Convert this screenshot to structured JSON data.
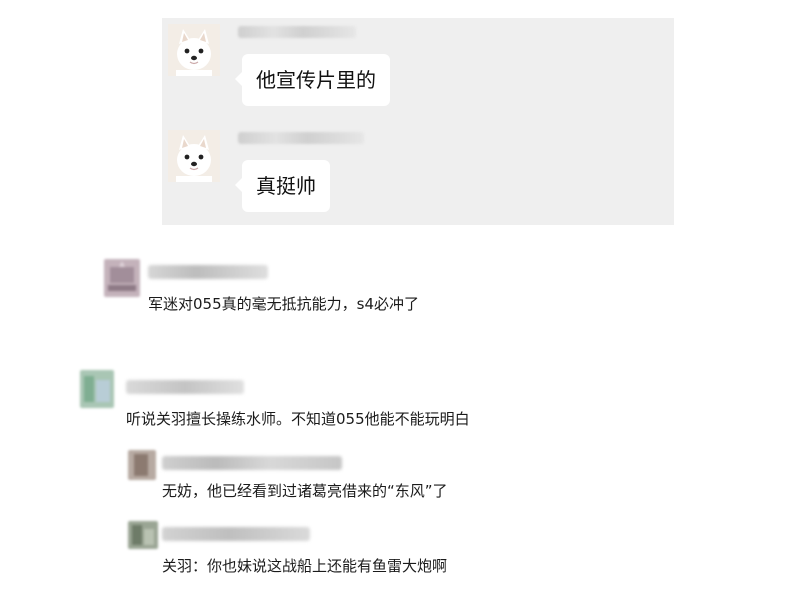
{
  "chat": {
    "messages": [
      {
        "text": "他宣传片里的",
        "avatar_icon": "white-dog-avatar-icon"
      },
      {
        "text": "真挺帅",
        "avatar_icon": "white-dog-avatar-icon"
      }
    ]
  },
  "comments": [
    {
      "text": "军迷对055真的毫无抵抗能力，s4必冲了",
      "level": "top",
      "avatar_color": "#b39aa6"
    },
    {
      "text": "听说关羽擅长操练水师。不知道055他能不能玩明白",
      "level": "top",
      "avatar_color": "#8fb7a0"
    },
    {
      "text": "无妨，他已经看到过诸葛亮借来的“东风”了",
      "level": "reply",
      "avatar_color": "#9a8a80"
    },
    {
      "text": "关羽：你也妹说这战船上还能有鱼雷大炮啊",
      "level": "reply",
      "avatar_color": "#7d8a7a"
    }
  ],
  "colors": {
    "chat_background": "#efefef",
    "bubble": "#ffffff",
    "text": "#1b1b1b"
  }
}
